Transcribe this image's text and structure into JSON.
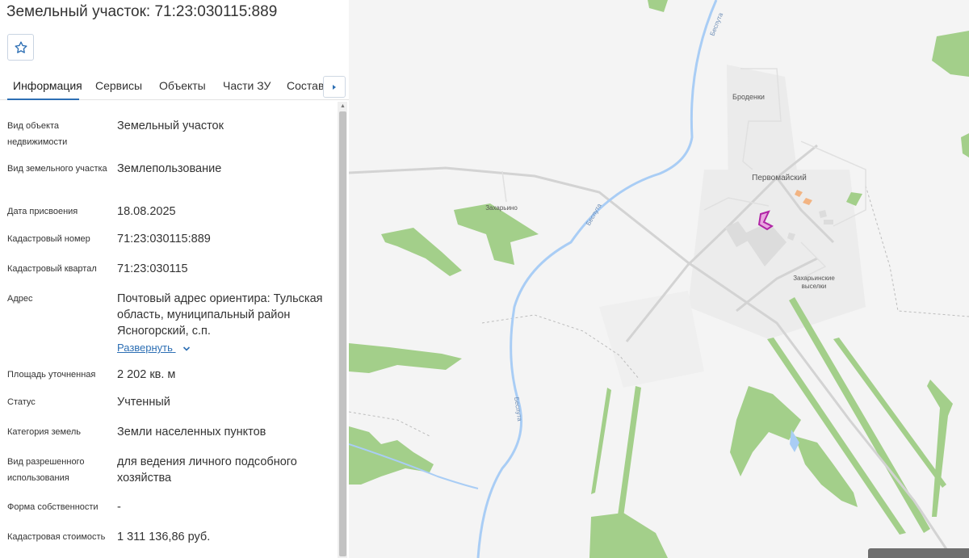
{
  "header": {
    "title": "Земельный участок: 71:23:030115:889",
    "favorite_icon": "star-outline-icon"
  },
  "tabs": [
    {
      "label": "Информация",
      "active": true
    },
    {
      "label": "Сервисы",
      "active": false
    },
    {
      "label": "Объекты",
      "active": false
    },
    {
      "label": "Части ЗУ",
      "active": false
    },
    {
      "label": "Состав",
      "active": false
    }
  ],
  "tabs_next_icon": "caret-right-icon",
  "properties": [
    {
      "label": "Вид объекта недвижимости",
      "value": "Земельный участок"
    },
    {
      "label": "Вид земельного участка",
      "value": "Землепользование"
    },
    {
      "label": "Дата присвоения",
      "value": "18.08.2025"
    },
    {
      "label": "Кадастровый номер",
      "value": "71:23:030115:889"
    },
    {
      "label": "Кадастровый квартал",
      "value": "71:23:030115"
    },
    {
      "label": "Адрес",
      "value": "Почтовый адрес ориентира: Тульская область, муниципальный район Ясногорский, с.п.",
      "expand_label": "Развернуть"
    },
    {
      "label": "Площадь уточненная",
      "value": "2 202 кв. м"
    },
    {
      "label": "Статус",
      "value": "Учтенный"
    },
    {
      "label": "Категория земель",
      "value": "Земли населенных пунктов"
    },
    {
      "label": "Вид разрешенного использования",
      "value": "для ведения личного подсобного хозяйства"
    },
    {
      "label": "Форма собственности",
      "value": "-"
    },
    {
      "label": "Кадастровая стоимость",
      "value": "1 311 136,86 руб."
    }
  ],
  "map": {
    "places": {
      "brodenki": "Броденки",
      "pervomaisky": "Первомайский",
      "zakharyino": "Захарьино",
      "vyselki": "Захарьинские выселки"
    },
    "river_name": "Беспута",
    "colors": {
      "background": "#f4f4f4",
      "forest": "#a3cf8a",
      "river": "#a9cdf5",
      "road": "#d7d7d7",
      "parcel": "#b124a6",
      "accent": "#2d6fb4"
    }
  }
}
